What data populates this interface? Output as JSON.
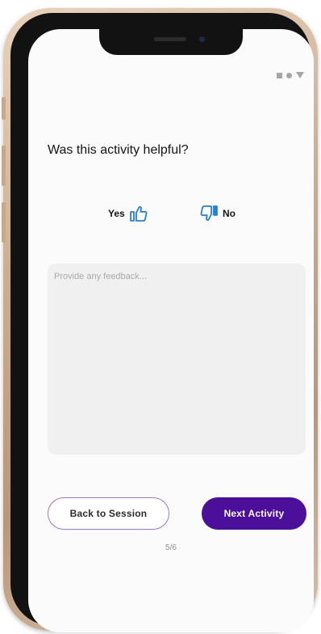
{
  "status_icons": [
    "square-icon",
    "dot-icon",
    "triangle-icon"
  ],
  "question": "Was this activity helpful?",
  "vote": {
    "yes_label": "Yes",
    "yes_icon": "thumbs-up-icon",
    "no_label": "No",
    "no_icon": "thumbs-down-icon",
    "icon_color": "#2a7fd4"
  },
  "feedback": {
    "placeholder": "Provide any feedback...",
    "value": ""
  },
  "buttons": {
    "back_label": "Back to Session",
    "next_label": "Next Activity"
  },
  "pager": "5/6",
  "colors": {
    "primary": "#4b0f9a",
    "outline": "#9c77c7",
    "feedback_bg": "#f0f0f0"
  }
}
